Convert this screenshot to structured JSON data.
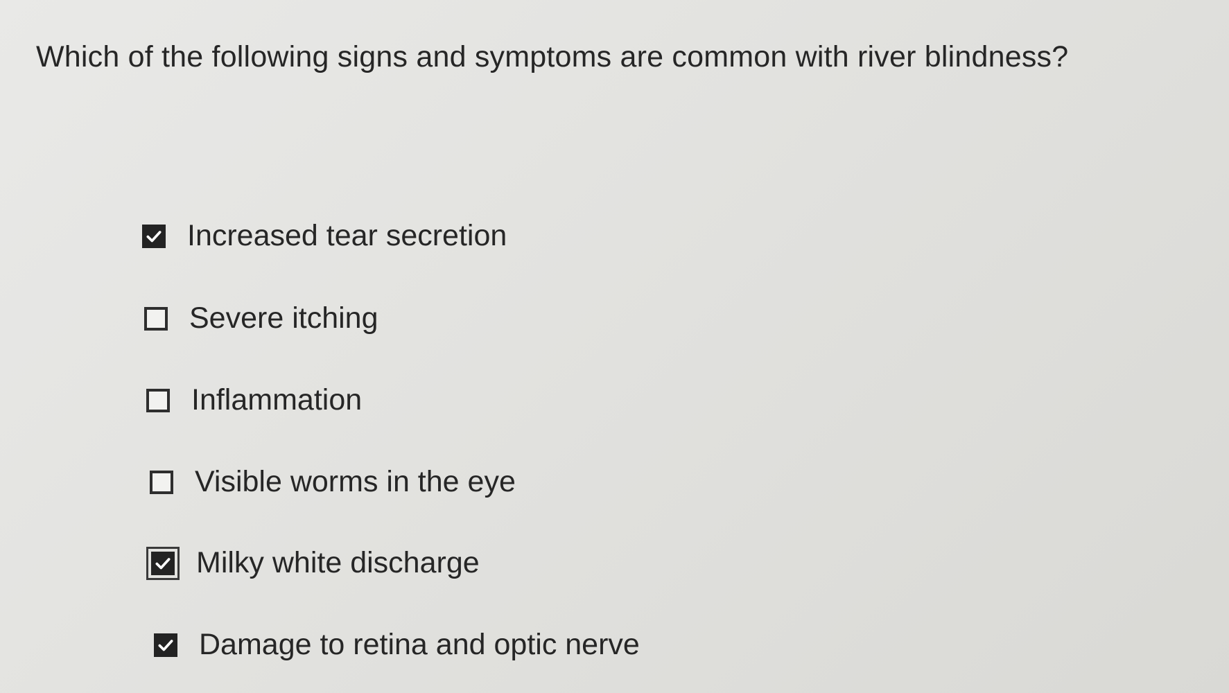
{
  "question": {
    "text": "Which of the following signs and symptoms are common with river blindness?"
  },
  "options": [
    {
      "label": "Increased tear secretion",
      "checked": true,
      "focused": false
    },
    {
      "label": "Severe itching",
      "checked": false,
      "focused": false
    },
    {
      "label": "Inflammation",
      "checked": false,
      "focused": false
    },
    {
      "label": "Visible worms in the eye",
      "checked": false,
      "focused": false
    },
    {
      "label": "Milky white discharge",
      "checked": true,
      "focused": true
    },
    {
      "label": "Damage to retina and optic nerve",
      "checked": true,
      "focused": false
    }
  ],
  "colors": {
    "background": "#e2e2df",
    "text": "#262626",
    "checkbox": "#232323"
  },
  "icons": {
    "checked": "checkmark-icon"
  }
}
